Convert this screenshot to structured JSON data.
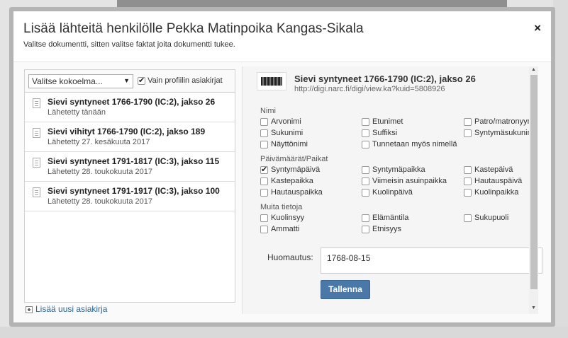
{
  "modal": {
    "title": "Lisää lähteitä henkilölle Pekka Matinpoika Kangas-Sikala",
    "subtitle": "Valitse dokumentti, sitten valitse faktat joita dokumentti tukee.",
    "close_label": "×"
  },
  "left": {
    "collection_select": "Valitse kokoelma...",
    "profile_only_label": "Vain profiilin asiakirjat",
    "documents": [
      {
        "title": "Sievi syntyneet 1766-1790 (IC:2), jakso 26",
        "date": "Lähetetty tänään"
      },
      {
        "title": "Sievi vihityt 1766-1790 (IC:2), jakso 189",
        "date": "Lähetetty 27. kesäkuuta 2017"
      },
      {
        "title": "Sievi syntyneet 1791-1817 (IC:3), jakso 115",
        "date": "Lähetetty 28. toukokuuta 2017"
      },
      {
        "title": "Sievi syntyneet 1791-1917 (IC:3), jakso 100",
        "date": "Lähetetty 28. toukokuuta 2017"
      }
    ],
    "add_document": "Lisää uusi asiakirja"
  },
  "right": {
    "source_title": "Sievi syntyneet 1766-1790 (IC:2), jakso 26",
    "source_url": "http://digi.narc.fi/digi/view.ka?kuid=5808926",
    "groups": {
      "name": {
        "label": "Nimi",
        "facts": [
          "Arvonimi",
          "Etunimet",
          "Patro/matronyymi",
          "Sukunimi",
          "Suffiksi",
          "Syntymäsukunimi",
          "Näyttönimi",
          "Tunnetaan myös nimellä"
        ]
      },
      "dates": {
        "label": "Päivämäärät/Paikat",
        "facts": [
          "Syntymäpäivä",
          "Syntymäpaikka",
          "Kastepäivä",
          "Kastepaikka",
          "Viimeisin asuinpaikka",
          "Hautauspäivä",
          "Hautauspaikka",
          "Kuolinpäivä",
          "Kuolinpaikka"
        ]
      },
      "other": {
        "label": "Muita tietoja",
        "facts": [
          "Kuolinsyy",
          "Elämäntila",
          "Sukupuoli",
          "Ammatti",
          "Etnisyys"
        ]
      }
    },
    "note_label": "Huomautus:",
    "note_value": "1768-08-15",
    "save_label": "Tallenna"
  }
}
